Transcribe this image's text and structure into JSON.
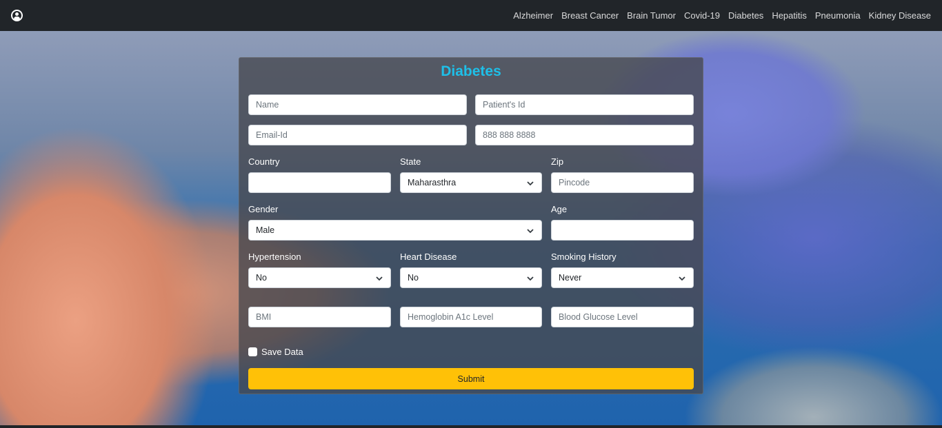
{
  "nav": {
    "links": [
      "Alzheimer",
      "Breast Cancer",
      "Brain Tumor",
      "Covid-19",
      "Diabetes",
      "Hepatitis",
      "Pneumonia",
      "Kidney Disease"
    ]
  },
  "form": {
    "title": "Diabetes",
    "name_placeholder": "Name",
    "patient_id_placeholder": "Patient's Id",
    "email_placeholder": "Email-Id",
    "phone_placeholder": "888 888 8888",
    "country_label": "Country",
    "country_value": "",
    "state_label": "State",
    "state_value": "Maharasthra",
    "zip_label": "Zip",
    "zip_placeholder": "Pincode",
    "gender_label": "Gender",
    "gender_value": "Male",
    "age_label": "Age",
    "age_value": "",
    "hypertension_label": "Hypertension",
    "hypertension_value": "No",
    "heart_label": "Heart Disease",
    "heart_value": "No",
    "smoking_label": "Smoking History",
    "smoking_value": "Never",
    "bmi_placeholder": "BMI",
    "hba1c_placeholder": "Hemoglobin A1c Level",
    "glucose_placeholder": "Blood Glucose Level",
    "save_label": "Save Data",
    "submit_label": "Submit"
  },
  "colors": {
    "navbar": "#212529",
    "title": "#1ebfe8",
    "submit": "#ffc107"
  }
}
